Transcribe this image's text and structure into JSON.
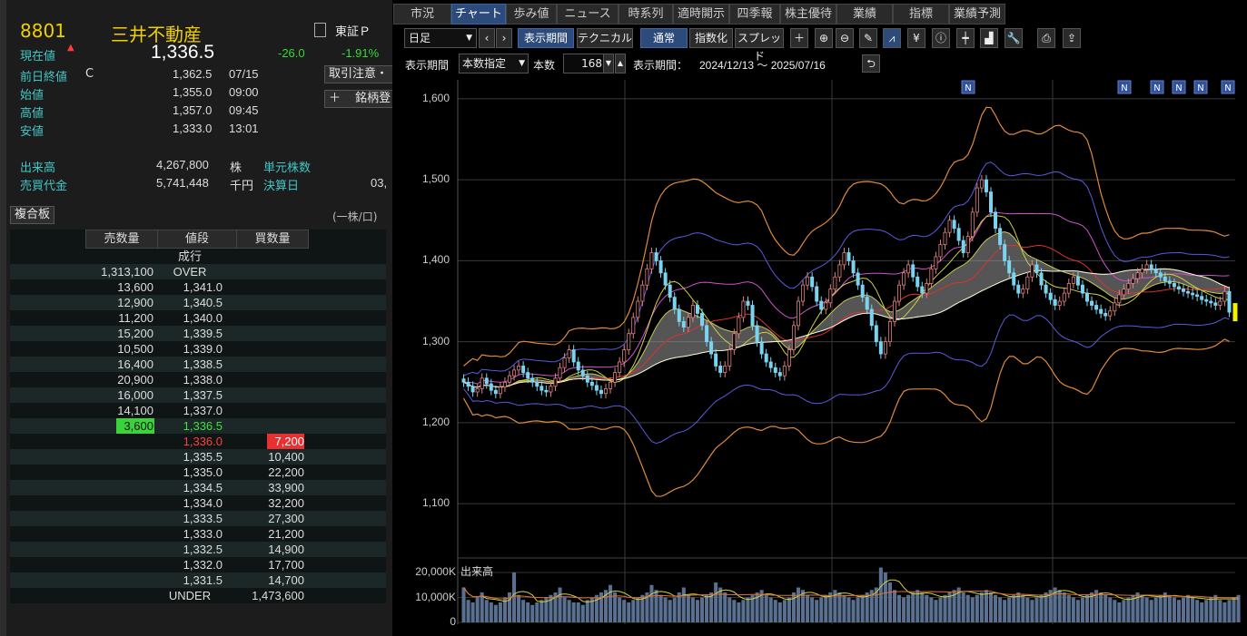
{
  "ticker": {
    "code": "8801",
    "name": "三井不動産",
    "market": "東証Ｐ",
    "current_label": "現在値",
    "price": "1,336.5",
    "change": "-26.0",
    "change_pct": "-1.91%",
    "prev_close_label": "前日終値",
    "prev_close_flag": "C",
    "prev_close": "1,362.5",
    "prev_close_date": "07/15",
    "open_label": "始値",
    "open": "1,355.0",
    "open_time": "09:00",
    "high_label": "高値",
    "high": "1,357.0",
    "high_time": "09:45",
    "low_label": "安値",
    "low": "1,333.0",
    "low_time": "13:01",
    "volume_label": "出来高",
    "volume": "4,267,800",
    "volume_unit": "株",
    "unit_shares_label": "単元株数",
    "turnover_label": "売買代金",
    "turnover": "5,741,448",
    "turnover_unit": "千円",
    "settlement_label": "決算日",
    "settlement_value": "03,",
    "caution_button": "取引注意・",
    "add_button": "銘柄登",
    "add_plus": "＋"
  },
  "board": {
    "title": "複合板",
    "unit_note": "(一株/口)",
    "headers": [
      "売数量",
      "値段",
      "買数量"
    ],
    "rows": [
      {
        "sell": "",
        "price": "成行",
        "buy": "",
        "type": "mkt"
      },
      {
        "sell": "1,313,100",
        "price": "OVER",
        "buy": "",
        "type": "over"
      },
      {
        "sell": "13,600",
        "price": "1,341.0",
        "buy": ""
      },
      {
        "sell": "12,900",
        "price": "1,340.5",
        "buy": ""
      },
      {
        "sell": "11,200",
        "price": "1,340.0",
        "buy": ""
      },
      {
        "sell": "15,200",
        "price": "1,339.5",
        "buy": ""
      },
      {
        "sell": "10,500",
        "price": "1,339.0",
        "buy": ""
      },
      {
        "sell": "16,400",
        "price": "1,338.5",
        "buy": ""
      },
      {
        "sell": "20,900",
        "price": "1,338.0",
        "buy": ""
      },
      {
        "sell": "16,000",
        "price": "1,337.5",
        "buy": ""
      },
      {
        "sell": "14,100",
        "price": "1,337.0",
        "buy": ""
      },
      {
        "sell": "3,600",
        "price": "1,336.5",
        "buy": "",
        "type": "best_ask"
      },
      {
        "sell": "",
        "price": "1,336.0",
        "buy": "7,200",
        "type": "best_bid"
      },
      {
        "sell": "",
        "price": "1,335.5",
        "buy": "10,400"
      },
      {
        "sell": "",
        "price": "1,335.0",
        "buy": "22,200"
      },
      {
        "sell": "",
        "price": "1,334.5",
        "buy": "33,900"
      },
      {
        "sell": "",
        "price": "1,334.0",
        "buy": "32,200"
      },
      {
        "sell": "",
        "price": "1,333.5",
        "buy": "27,300"
      },
      {
        "sell": "",
        "price": "1,333.0",
        "buy": "21,200"
      },
      {
        "sell": "",
        "price": "1,332.5",
        "buy": "14,900"
      },
      {
        "sell": "",
        "price": "1,332.0",
        "buy": "17,700"
      },
      {
        "sell": "",
        "price": "1,331.5",
        "buy": "14,700"
      },
      {
        "sell": "",
        "price": "UNDER",
        "buy": "1,473,600",
        "type": "under"
      }
    ]
  },
  "tabs": [
    "市況",
    "チャート",
    "歩み値",
    "ニュース",
    "時系列",
    "適時開示",
    "四季報",
    "株主優待",
    "業績",
    "指標",
    "業績予測"
  ],
  "active_tab": "チャート",
  "toolbar": {
    "period_select": "日足",
    "display_period_btn": "表示期間",
    "technical_btn": "テクニカル",
    "normal_btn": "通常",
    "index_btn": "指数化",
    "spread_btn": "スプレッド",
    "range_label": "表示期間",
    "range_select": "本数指定",
    "count_label": "本数",
    "count_value": "168",
    "period_text_label": "表示期間：",
    "period_text": "2024/12/13 ～ 2025/07/16"
  },
  "chart_data": {
    "type": "candlestick",
    "y_ticks": [
      "1,600",
      "1,500",
      "1,400",
      "1,300",
      "1,200",
      "1,100"
    ],
    "ylim": [
      1080,
      1610
    ],
    "news_badge": "N",
    "volume_label": "出来高",
    "volume_ticks": [
      "20,000K",
      "10,000K",
      "0"
    ],
    "last_close": 1336.5,
    "closes": [
      1250,
      1245,
      1238,
      1242,
      1255,
      1248,
      1240,
      1236,
      1244,
      1250,
      1258,
      1265,
      1270,
      1262,
      1255,
      1250,
      1245,
      1240,
      1238,
      1245,
      1255,
      1268,
      1280,
      1290,
      1275,
      1265,
      1258,
      1250,
      1246,
      1240,
      1236,
      1242,
      1250,
      1262,
      1275,
      1290,
      1310,
      1330,
      1350,
      1370,
      1390,
      1410,
      1400,
      1385,
      1370,
      1355,
      1340,
      1325,
      1318,
      1330,
      1345,
      1335,
      1320,
      1300,
      1285,
      1270,
      1262,
      1270,
      1290,
      1310,
      1330,
      1350,
      1345,
      1320,
      1300,
      1285,
      1275,
      1268,
      1262,
      1258,
      1270,
      1290,
      1320,
      1350,
      1370,
      1380,
      1368,
      1350,
      1340,
      1348,
      1365,
      1380,
      1395,
      1410,
      1400,
      1385,
      1370,
      1355,
      1340,
      1320,
      1300,
      1285,
      1300,
      1325,
      1350,
      1370,
      1385,
      1395,
      1380,
      1368,
      1360,
      1372,
      1390,
      1405,
      1420,
      1435,
      1450,
      1440,
      1425,
      1410,
      1430,
      1460,
      1490,
      1500,
      1485,
      1460,
      1440,
      1420,
      1400,
      1385,
      1370,
      1360,
      1365,
      1380,
      1395,
      1385,
      1370,
      1360,
      1352,
      1345,
      1350,
      1360,
      1372,
      1380,
      1370,
      1360,
      1350,
      1345,
      1340,
      1335,
      1332,
      1338,
      1348,
      1358,
      1365,
      1372,
      1378,
      1385,
      1390,
      1395,
      1390,
      1385,
      1380,
      1375,
      1372,
      1368,
      1365,
      1362,
      1360,
      1358,
      1356,
      1352,
      1350,
      1348,
      1345,
      1350,
      1362,
      1336.5
    ],
    "volumes": [
      14,
      9,
      8,
      10,
      12,
      9,
      8,
      7,
      8,
      10,
      12,
      20,
      11,
      9,
      8,
      7,
      8,
      9,
      10,
      11,
      12,
      14,
      10,
      9,
      8,
      8,
      7,
      9,
      10,
      11,
      12,
      13,
      15,
      12,
      10,
      9,
      8,
      9,
      10,
      11,
      12,
      15,
      13,
      11,
      10,
      9,
      10,
      12,
      14,
      11,
      10,
      9,
      10,
      11,
      12,
      16,
      14,
      12,
      10,
      9,
      8,
      9,
      10,
      11,
      12,
      13,
      11,
      10,
      9,
      8,
      9,
      10,
      12,
      14,
      13,
      11,
      10,
      9,
      10,
      11,
      12,
      13,
      12,
      11,
      10,
      9,
      10,
      11,
      12,
      13,
      14,
      22,
      20,
      16,
      13,
      11,
      10,
      11,
      12,
      13,
      12,
      11,
      10,
      9,
      10,
      11,
      12,
      13,
      14,
      12,
      11,
      10,
      11,
      12,
      13,
      12,
      11,
      10,
      9,
      10,
      11,
      12,
      11,
      10,
      9,
      10,
      11,
      12,
      13,
      14,
      13,
      12,
      11,
      10,
      9,
      10,
      11,
      12,
      13,
      12,
      11,
      10,
      9,
      8,
      9,
      10,
      11,
      12,
      11,
      10,
      9,
      10,
      11,
      12,
      11,
      10,
      9,
      10,
      11,
      10,
      9,
      8,
      9,
      10,
      11,
      9,
      8,
      9,
      10,
      11
    ]
  }
}
